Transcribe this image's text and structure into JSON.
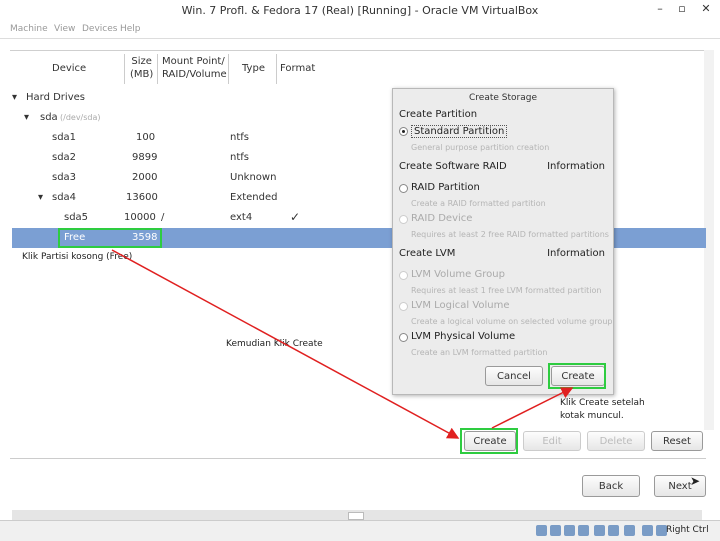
{
  "window": {
    "title": "Win. 7 Profl. & Fedora 17 (Real) [Running] - Oracle VM VirtualBox"
  },
  "menu": [
    "Machine",
    "View",
    "Devices",
    "Help"
  ],
  "table": {
    "headers": {
      "device": "Device",
      "size": "Size\n(MB)",
      "mount": "Mount Point/\nRAID/Volume",
      "type": "Type",
      "format": "Format"
    },
    "group": "Hard Drives",
    "disk": {
      "name": "sda",
      "path": "(/dev/sda)"
    },
    "rows": [
      {
        "device": "sda1",
        "size": "100",
        "mount": "",
        "type": "ntfs",
        "format": ""
      },
      {
        "device": "sda2",
        "size": "9899",
        "mount": "",
        "type": "ntfs",
        "format": ""
      },
      {
        "device": "sda3",
        "size": "2000",
        "mount": "",
        "type": "Unknown",
        "format": ""
      },
      {
        "device": "sda4",
        "size": "13600",
        "mount": "",
        "type": "Extended",
        "format": ""
      },
      {
        "device": "sda5",
        "size": "10000",
        "mount": "/",
        "type": "ext4",
        "format": "✓"
      },
      {
        "device": "Free",
        "size": "3598",
        "mount": "",
        "type": "",
        "format": ""
      }
    ]
  },
  "dialog": {
    "title": "Create Storage",
    "section_partition": "Create Partition",
    "standard": {
      "label": "Standard Partition",
      "desc": "General purpose partition creation"
    },
    "section_raid": "Create Software RAID",
    "info1": "Information",
    "raid_partition": {
      "label": "RAID Partition",
      "desc": "Create a RAID formatted partition"
    },
    "raid_device": {
      "label": "RAID Device",
      "desc": "Requires at least 2 free RAID formatted partitions"
    },
    "section_lvm": "Create LVM",
    "info2": "Information",
    "lvm_group": {
      "label": "LVM Volume Group",
      "desc": "Requires at least 1 free LVM formatted partition"
    },
    "lvm_logical": {
      "label": "LVM Logical Volume",
      "desc": "Create a logical volume on selected volume group"
    },
    "lvm_physical": {
      "label": "LVM Physical Volume",
      "desc": "Create an LVM formatted partition"
    },
    "cancel": "Cancel",
    "create": "Create"
  },
  "buttons": {
    "create": "Create",
    "edit": "Edit",
    "delete": "Delete",
    "reset": "Reset",
    "back": "Back",
    "next": "Next"
  },
  "annotations": {
    "free": "Klik Partisi kosong (Free)",
    "middle": "Kemudian Klik Create",
    "right_line1": "Klik Create setelah",
    "right_line2": "kotak muncul."
  },
  "status": {
    "host_key": "Right Ctrl"
  },
  "colors": {
    "highlight": "#7b9fd3",
    "annotation_box": "#2ecc40",
    "arrow": "#e02020"
  }
}
